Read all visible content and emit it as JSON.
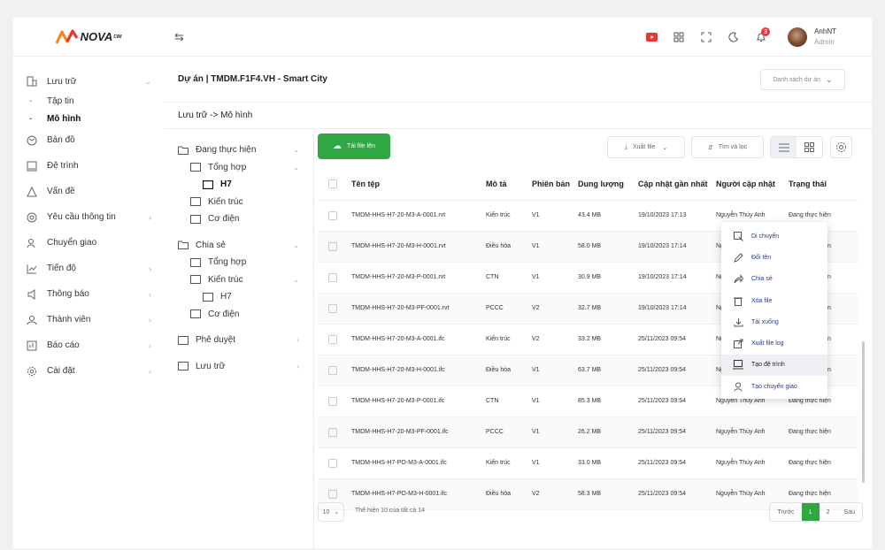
{
  "brand": {
    "name": "NOVA",
    "sup": "CIM"
  },
  "header": {
    "user_name": "AnhNT",
    "user_role": "Admin",
    "notification_count": "3",
    "icons": [
      "youtube-icon",
      "apps-grid-icon",
      "fullscreen-icon",
      "dark-mode-icon",
      "bell-icon"
    ]
  },
  "sidebar": {
    "items": [
      {
        "label": "Lưu trữ",
        "icon": "storage-icon",
        "expanded": true
      },
      {
        "label": "Bản đồ",
        "icon": "map-icon"
      },
      {
        "label": "Đệ trình",
        "icon": "submit-icon"
      },
      {
        "label": "Vấn đề",
        "icon": "issue-icon"
      },
      {
        "label": "Yêu cầu thông tin",
        "icon": "info-request-icon"
      },
      {
        "label": "Chuyển giao",
        "icon": "handover-icon"
      },
      {
        "label": "Tiến độ",
        "icon": "progress-icon"
      },
      {
        "label": "Thông báo",
        "icon": "announcement-icon"
      },
      {
        "label": "Thành viên",
        "icon": "members-icon"
      },
      {
        "label": "Báo cáo",
        "icon": "report-icon"
      },
      {
        "label": "Cài đặt",
        "icon": "settings-icon"
      }
    ],
    "sub": [
      {
        "label": "Tập tin"
      },
      {
        "label": "Mô hình",
        "active": true
      }
    ]
  },
  "project": {
    "title": "Dự án  | TMDM.F1F4.VH - Smart City",
    "selector_label": "Danh sách dự án",
    "breadcrumb": "Lưu trữ -> Mô hình"
  },
  "tree": {
    "nodes": [
      {
        "label": "Đang thực hiện",
        "level": 0,
        "open": true
      },
      {
        "label": "Tổng hợp",
        "level": 1,
        "open": true
      },
      {
        "label": "H7",
        "level": 2,
        "bold": true
      },
      {
        "label": "Kiến trúc",
        "level": 1
      },
      {
        "label": "Cơ điện",
        "level": 1
      },
      {
        "label": "Chia sẻ",
        "level": 0,
        "open": true
      },
      {
        "label": "Tổng hợp",
        "level": 1
      },
      {
        "label": "Kiến trúc",
        "level": 1,
        "open": true
      },
      {
        "label": "H7",
        "level": 2
      },
      {
        "label": "Cơ điện",
        "level": 1
      },
      {
        "label": "Phê duyệt",
        "level": 0
      },
      {
        "label": "Lưu trữ",
        "level": 0
      }
    ]
  },
  "toolbar": {
    "upload_label": "Tải file lên",
    "export_label": "Xuất file",
    "search_filter_label": "Tìm và lọc"
  },
  "table": {
    "columns": [
      "Tên tệp",
      "Mô tả",
      "Phiên bản",
      "Dung lượng",
      "Cập nhật gần nhất",
      "Người cập nhật",
      "Trạng thái"
    ],
    "rows": [
      [
        "TMDM-HHS-H7-20-M3-A-0001.rvt",
        "Kiến trúc",
        "V1",
        "43.4 MB",
        "19/10/2023 17:13",
        "Nguyễn Thùy Anh",
        "Đang thực hiện"
      ],
      [
        "TMDM-HHS-H7-20-M3-H-0001.rvt",
        "Điều hòa",
        "V1",
        "58.0 MB",
        "19/10/2023 17:14",
        "Nguyễn Thùy Anh",
        "Đang thực hiện"
      ],
      [
        "TMDM-HHS-H7-20-M3-P-0001.rvt",
        "CTN",
        "V1",
        "30.9 MB",
        "19/10/2023 17:14",
        "Nguyễn Thùy Anh",
        "Đang thực hiện"
      ],
      [
        "TMDM-HHS-H7-20-M3-PF-0001.rvt",
        "PCCC",
        "V2",
        "32.7 MB",
        "19/10/2023 17:14",
        "Nguyễn Thùy Anh",
        "Đang thực hiện"
      ],
      [
        "TMDM-HHS-H7-20-M3-A-0001.ifc",
        "Kiến trúc",
        "V2",
        "33.2 MB",
        "25/11/2023 09:54",
        "Nguyễn Thùy Anh",
        "Đang thực hiện"
      ],
      [
        "TMDM-HHS-H7-20-M3-H-0001.ifc",
        "Điều hòa",
        "V1",
        "63.7 MB",
        "25/11/2023 09:54",
        "Nguyễn Thùy Anh",
        "Đang thực hiện"
      ],
      [
        "TMDM-HHS-H7-20-M3-P-0001.ifc",
        "CTN",
        "V1",
        "85.3 MB",
        "25/11/2023 09:54",
        "Nguyễn Thùy Anh",
        "Đang thực hiện"
      ],
      [
        "TMDM-HHS-H7-20-M3-PF-0001.ifc",
        "PCCC",
        "V1",
        "26.2 MB",
        "25/11/2023 09:54",
        "Nguyễn Thùy Anh",
        "Đang thực hiện"
      ],
      [
        "TMDM-HHS-H7-PO-M3-A-0001.ifc",
        "Kiến trúc",
        "V1",
        "33.0 MB",
        "25/11/2023 09:54",
        "Nguyễn Thùy Anh",
        "Đang thực hiện"
      ],
      [
        "TMDM-HHS-H7-PO-M3-H-0001.ifc",
        "Điều hòa",
        "V2",
        "58.3 MB",
        "25/11/2023 09:54",
        "Nguyễn Thùy Anh",
        "Đang thực hiện"
      ]
    ]
  },
  "pagination": {
    "page_size": "10",
    "info": "Thể hiện 10 của tất cả 14",
    "prev_label": "Trước",
    "pages": [
      "1",
      "2"
    ],
    "current": "1",
    "next_label": "Sau"
  },
  "context_menu": {
    "items": [
      {
        "label": "Di chuyển",
        "icon": "move-icon"
      },
      {
        "label": "Đổi tên",
        "icon": "rename-icon"
      },
      {
        "label": "Chia sẻ",
        "icon": "share-icon"
      },
      {
        "label": "Xóa file",
        "icon": "delete-icon"
      },
      {
        "label": "Tải xuống",
        "icon": "download-icon"
      },
      {
        "label": "Xuất file log",
        "icon": "export-log-icon"
      },
      {
        "label": "Tạo đệ trình",
        "icon": "create-submission-icon",
        "highlighted": true
      },
      {
        "label": "Tạo chuyển giao",
        "icon": "create-handover-icon"
      }
    ]
  },
  "colors": {
    "accent": "#2fa742",
    "brand_orange": "#f28a1c",
    "brand_red": "#e53935"
  }
}
